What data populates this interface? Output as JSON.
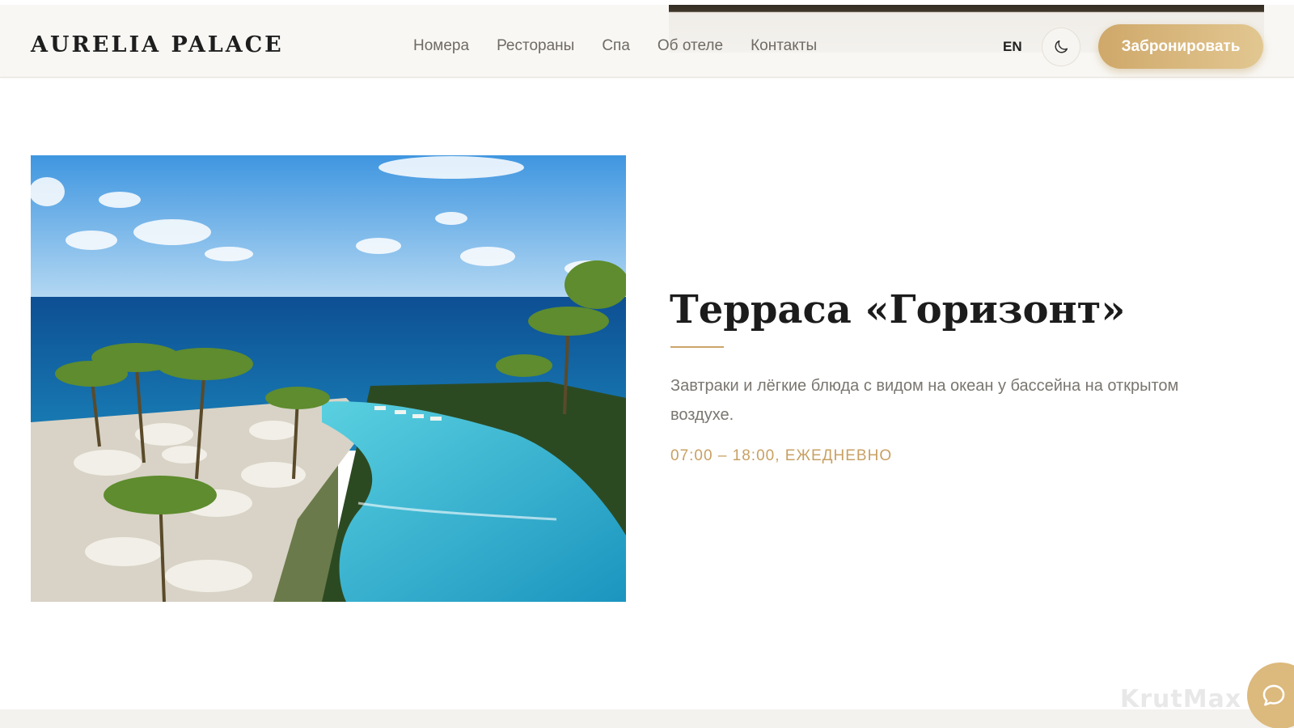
{
  "header": {
    "logo": "AURELIA PALACE",
    "nav": [
      "Номера",
      "Рестораны",
      "Спа",
      "Об отеле",
      "Контакты"
    ],
    "language": "EN",
    "theme_toggle_icon": "moon-icon",
    "book_label": "Забронировать"
  },
  "restaurant": {
    "photo_alt": "pool-terrace-ocean-photo",
    "title": "Терраса «Горизонт»",
    "description": "Завтраки и лёгкие блюда с видом на океан у бассейна на открытом воздухе.",
    "hours": "07:00 – 18:00, ЕЖЕДНЕВНО"
  },
  "watermark": "KrutMax",
  "chat_icon": "chat-bubble-icon",
  "colors": {
    "accent_gold": "#c8a063",
    "button_gold": "#d8b77a",
    "text_dark": "#1c1c1c",
    "text_muted": "#7a7670",
    "header_bg": "#f8f7f4"
  }
}
